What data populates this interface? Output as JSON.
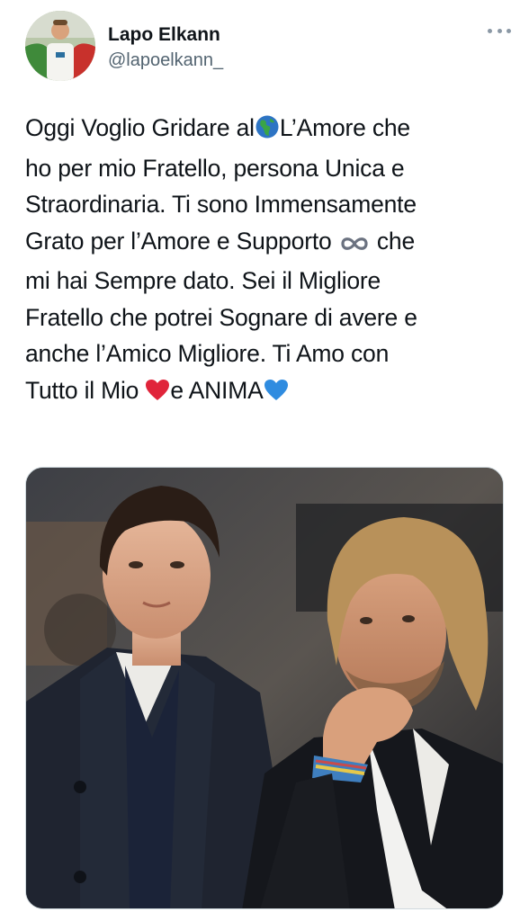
{
  "tweet": {
    "author": {
      "display_name": "Lapo Elkann",
      "handle": "@lapoelkann_",
      "avatar_icon": "profile-photo"
    },
    "more_icon": "more-horizontal-icon",
    "text_lines": [
      {
        "before": "Oggi Voglio Gridare al",
        "emoji": "globe-europe-africa",
        "after": "L’Amore che"
      },
      {
        "text": "ho per mio Fratello, persona Unica e"
      },
      {
        "text": "Straordinaria. Ti sono Immensamente"
      },
      {
        "before": "Grato per l’Amore e Supporto ",
        "emoji": "infinity",
        "after": " che"
      },
      {
        "text": "mi hai Sempre dato. Sei il Migliore"
      },
      {
        "text": "Fratello che potrei Sognare di avere e"
      },
      {
        "text": "anche l’Amico Migliore. Ti Amo con"
      },
      {
        "before": "Tutto il Mio ",
        "emoji": "red-heart",
        "middle": "e ANIMA",
        "emoji2": "blue-heart"
      }
    ],
    "media": {
      "type": "photo",
      "alt_subject": "two men in dark jackets, one looking to the side, one with hand on chin"
    },
    "colors": {
      "text": "#0f1419",
      "secondary": "#536471",
      "heart_red": "#e0243a",
      "heart_blue": "#2f8ce0"
    }
  }
}
